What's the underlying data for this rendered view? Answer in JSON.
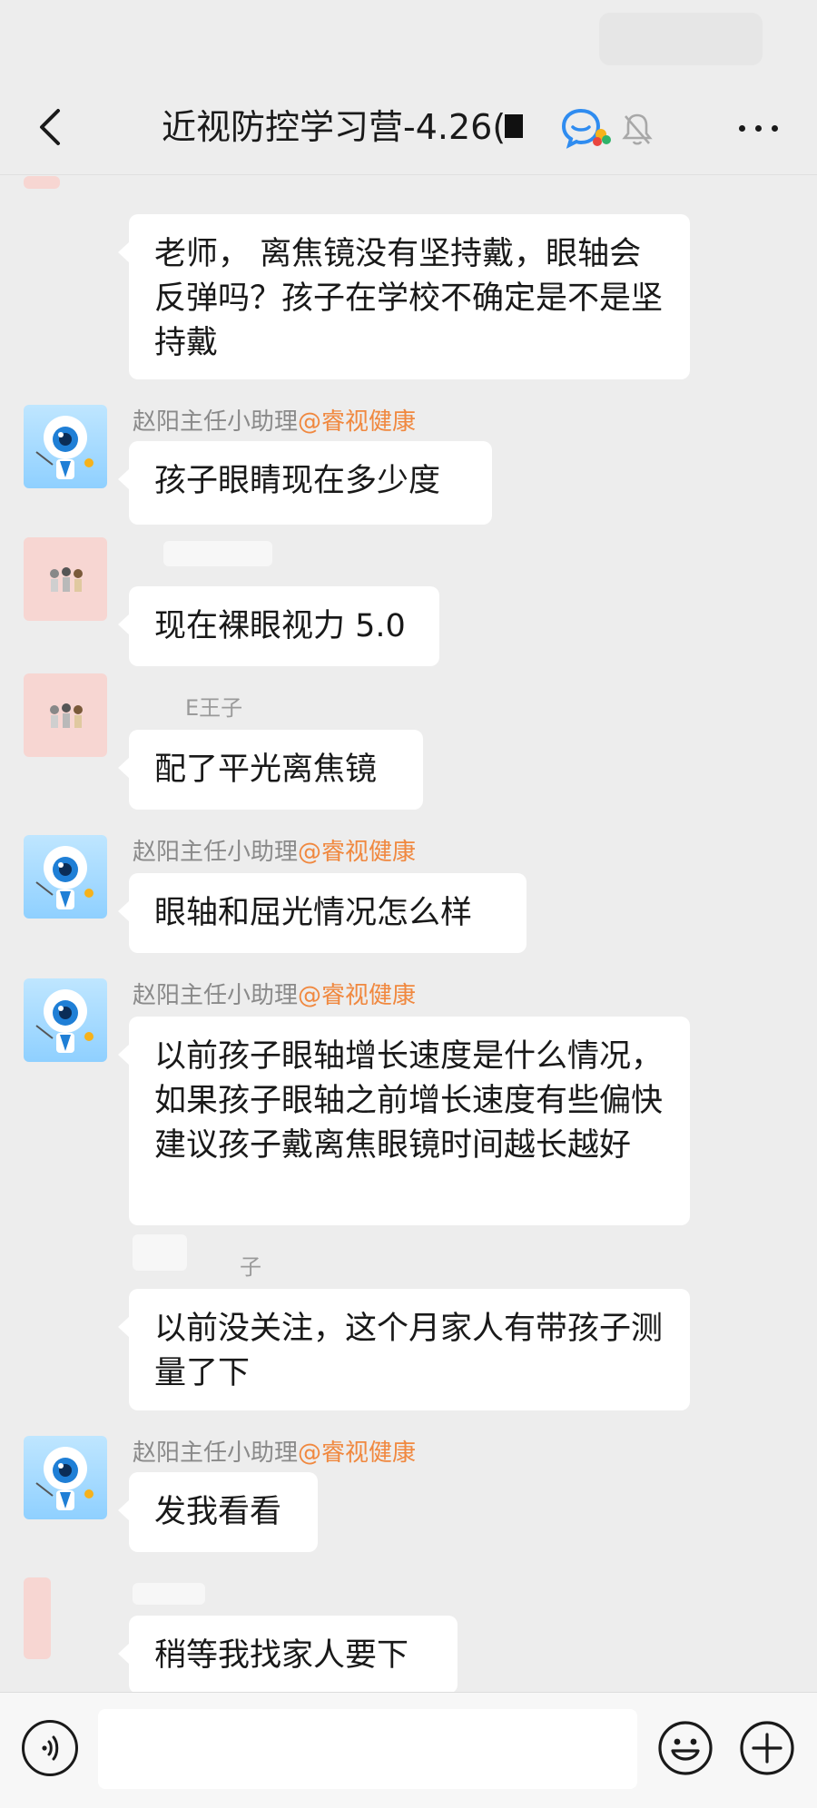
{
  "header": {
    "title": "近视防控学习营-4.26(",
    "icons": [
      "back-arrow-icon",
      "chat-bubble-icon",
      "mute-bell-icon",
      "more-dots-icon"
    ]
  },
  "messages": [
    {
      "text": "老师， 离焦镜没有坚持戴，眼轴会反弹吗？孩子在学校不确定是不是坚持戴"
    },
    {
      "sender_name": "赵阳主任小助理",
      "sender_org": "@睿视健康",
      "text": "孩子眼睛现在多少度"
    },
    {
      "text": "现在裸眼视力 5.0"
    },
    {
      "sender_name": "E王子",
      "text": "配了平光离焦镜"
    },
    {
      "sender_name": "赵阳主任小助理",
      "sender_org": "@睿视健康",
      "text": "眼轴和屈光情况怎么样"
    },
    {
      "sender_name": "赵阳主任小助理",
      "sender_org": "@睿视健康",
      "text": "以前孩子眼轴增长速度是什么情况，如果孩子眼轴之前增长速度有些偏快建议孩子戴离焦眼镜时间越长越好"
    },
    {
      "sender_name": "子",
      "text": "以前没关注，这个月家人有带孩子测量了下"
    },
    {
      "sender_name": "赵阳主任小助理",
      "sender_org": "@睿视健康",
      "text": "发我看看"
    },
    {
      "text": "稍等我找家人要下"
    }
  ],
  "input_bar": {
    "icons": [
      "voice-icon",
      "emoji-icon",
      "plus-icon"
    ]
  },
  "colors": {
    "background": "#ededed",
    "bubble": "#ffffff",
    "sender_org": "#f0883f",
    "sender_name": "#8a8a8a"
  }
}
